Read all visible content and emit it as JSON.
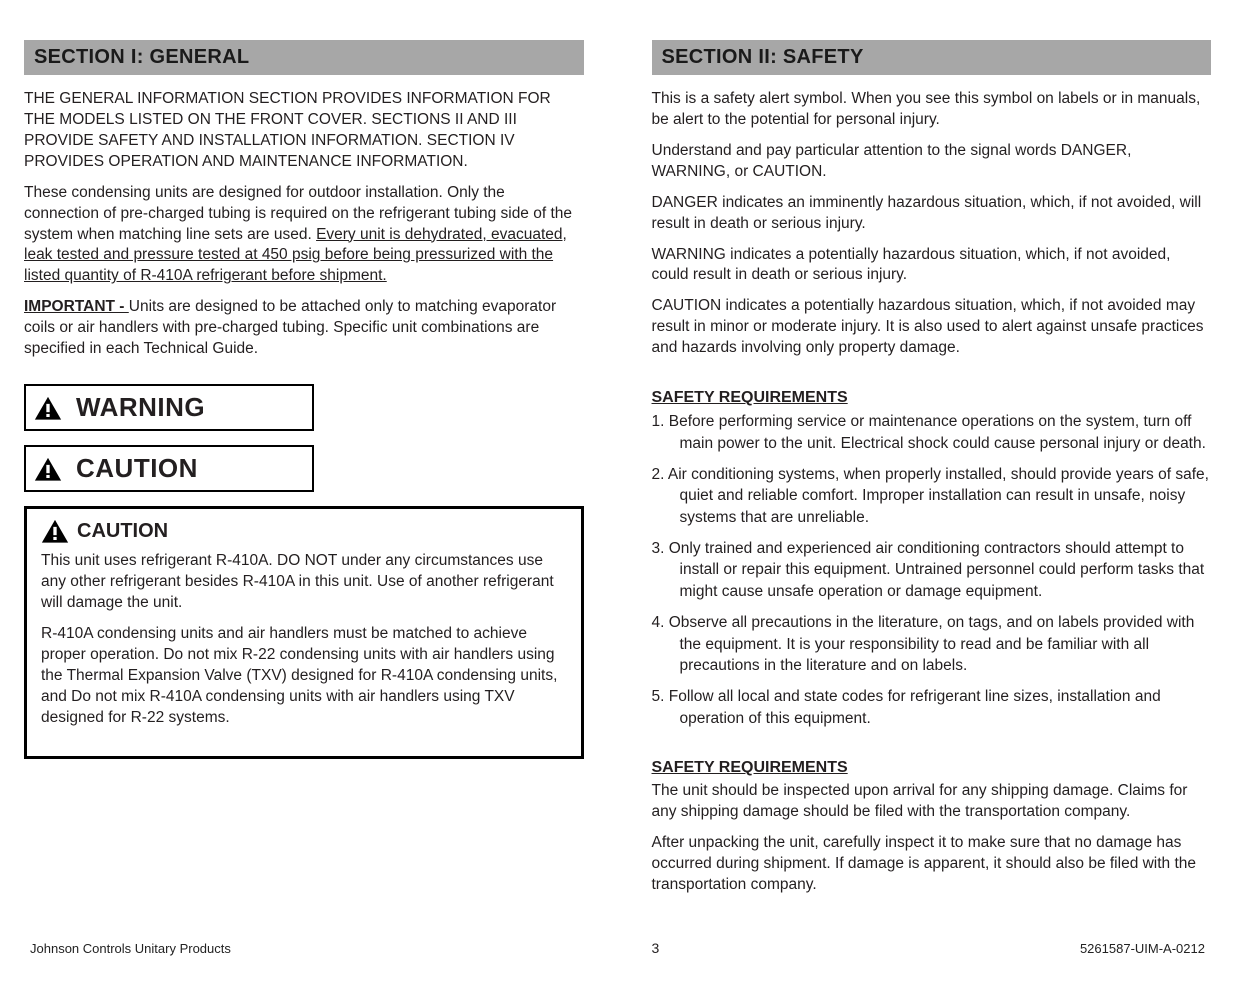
{
  "footer": {
    "left": "Johnson Controls Unitary Products",
    "center": "3",
    "right": "5261587-UIM-A-0212"
  },
  "left": {
    "bar": "SECTION I: GENERAL",
    "p1": "THE GENERAL INFORMATION SECTION PROVIDES INFORMATION FOR THE MODELS LISTED ON THE FRONT COVER. SECTIONS II AND III PROVIDE SAFETY AND INSTALLATION INFORMATION. SECTION IV PROVIDES OPERATION AND MAINTENANCE INFORMATION.",
    "p2_a": "These condensing units are designed for outdoor installation. Only the connection of pre-charged tubing is required on the refrigerant tubing side of the system when matching line sets are used.",
    "p2_b": "Every unit is dehydrated, evacuated, leak tested and pressure tested at 450 psig before being pressurized with the listed quantity of R-410A refrigerant before shipment.",
    "p3": "Units are designed to be attached only to matching evaporator coils or air handlers with pre-charged tubing. Specific unit combinations are specified in each Technical Guide.",
    "warn_label": "WARNING",
    "caut_label": "CAUTION",
    "caut_header": "CAUTION",
    "caution_body_1": "This unit uses refrigerant R-410A. DO NOT under any circumstances use any other refrigerant besides R-410A in this unit. Use of another refrigerant will damage the unit.",
    "caution_body_2": "R-410A condensing units and air handlers must be matched to achieve proper operation. Do not mix R-22 condensing units with air handlers using the Thermal Expansion Valve (TXV) designed for R-410A condensing units, and Do not mix R-410A condensing units with air handlers using TXV designed for R-22 systems."
  },
  "right": {
    "bar": "SECTION II: SAFETY",
    "p1": "This is a safety alert symbol. When you see this symbol on labels or in manuals, be alert to the potential for personal injury.",
    "p2": "Understand and pay particular attention to the signal words DANGER, WARNING, or CAUTION.",
    "p3": "DANGER indicates an imminently hazardous situation, which, if not avoided, will result in death or serious injury.",
    "p4": "WARNING indicates a potentially hazardous situation, which, if not avoided, could result in death or serious injury.",
    "p5": "CAUTION indicates a potentially hazardous situation, which, if not avoided may result in minor or moderate injury. It is also used to alert against unsafe practices and hazards involving only property damage.",
    "sub1": "SAFETY REQUIREMENTS",
    "s1_1": "1.     Before performing service or maintenance operations on the system, turn off main power to the unit. Electrical shock could cause personal injury or death.",
    "s1_2": "2.     Air conditioning systems, when properly installed, should provide years of safe, quiet and reliable comfort. Improper installation can result in unsafe, noisy systems that are unreliable.",
    "s1_3": "3.     Only trained and experienced air conditioning contractors should attempt to install or repair this equipment. Untrained personnel could perform tasks that might cause unsafe operation or damage equipment.",
    "s1_4": "4.     Observe all precautions in the literature, on tags, and on labels provided with the equipment. It is your responsibility to read and be familiar with all precautions in the literature and on labels.",
    "s1_5": "5.     Follow all local and state codes for refrigerant line sizes, installation and operation of this equipment.",
    "sub2": "SAFETY REQUIREMENTS",
    "insp_p1": "The unit should be inspected upon arrival for any shipping damage. Claims for any shipping damage should be filed with the transportation company.",
    "insp_p2": "After unpacking the unit, carefully inspect it to make sure that no damage has occurred during shipment. If damage is apparent, it should also be filed with the transportation company."
  }
}
